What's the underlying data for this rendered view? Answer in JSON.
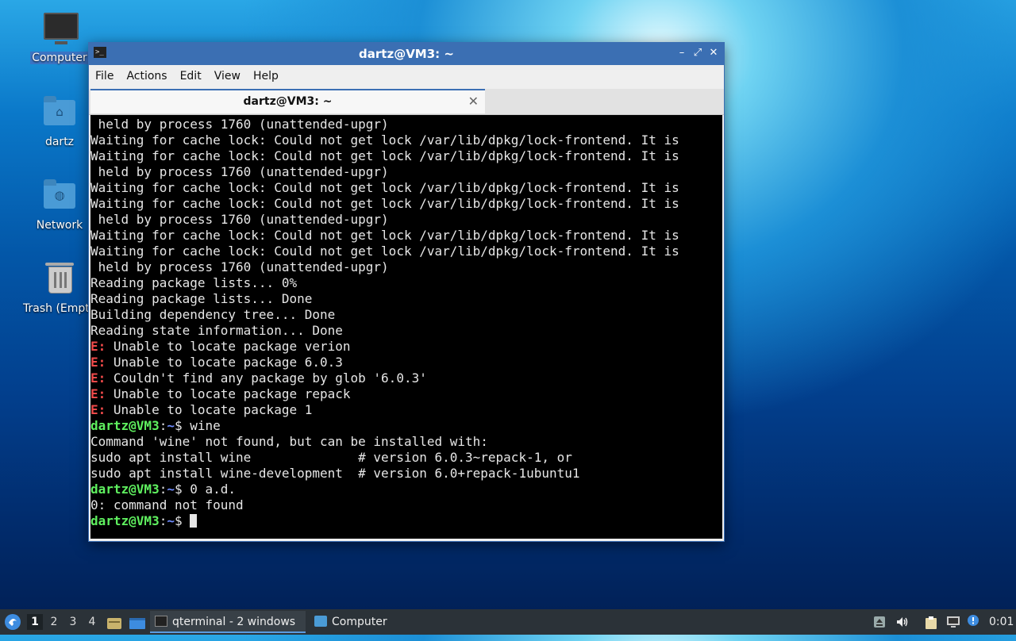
{
  "desktop": {
    "icons": [
      {
        "label": "Computer"
      },
      {
        "label": "dartz"
      },
      {
        "label": "Network"
      },
      {
        "label": "Trash (Empty)"
      }
    ]
  },
  "window": {
    "title": "dartz@VM3: ~",
    "controls": {
      "minimize": "–",
      "maximize": "⤢",
      "close": "✕"
    },
    "menu": [
      "File",
      "Actions",
      "Edit",
      "View",
      "Help"
    ],
    "tab": {
      "label": "dartz@VM3: ~",
      "close": "✕"
    }
  },
  "terminal": {
    "lines": [
      {
        "kind": "text",
        "text": " held by process 1760 (unattended-upgr)"
      },
      {
        "kind": "text",
        "text": "Waiting for cache lock: Could not get lock /var/lib/dpkg/lock-frontend. It is"
      },
      {
        "kind": "text",
        "text": "Waiting for cache lock: Could not get lock /var/lib/dpkg/lock-frontend. It is"
      },
      {
        "kind": "text",
        "text": " held by process 1760 (unattended-upgr)"
      },
      {
        "kind": "text",
        "text": "Waiting for cache lock: Could not get lock /var/lib/dpkg/lock-frontend. It is"
      },
      {
        "kind": "text",
        "text": "Waiting for cache lock: Could not get lock /var/lib/dpkg/lock-frontend. It is"
      },
      {
        "kind": "text",
        "text": " held by process 1760 (unattended-upgr)"
      },
      {
        "kind": "text",
        "text": "Waiting for cache lock: Could not get lock /var/lib/dpkg/lock-frontend. It is"
      },
      {
        "kind": "text",
        "text": "Waiting for cache lock: Could not get lock /var/lib/dpkg/lock-frontend. It is"
      },
      {
        "kind": "text",
        "text": " held by process 1760 (unattended-upgr)"
      },
      {
        "kind": "text",
        "text": "Reading package lists... 0%"
      },
      {
        "kind": "text",
        "text": "Reading package lists... Done"
      },
      {
        "kind": "text",
        "text": "Building dependency tree... Done"
      },
      {
        "kind": "text",
        "text": "Reading state information... Done"
      },
      {
        "kind": "error",
        "prefix": "E:",
        "text": " Unable to locate package verion"
      },
      {
        "kind": "error",
        "prefix": "E:",
        "text": " Unable to locate package 6.0.3"
      },
      {
        "kind": "error",
        "prefix": "E:",
        "text": " Couldn't find any package by glob '6.0.3'"
      },
      {
        "kind": "error",
        "prefix": "E:",
        "text": " Unable to locate package repack"
      },
      {
        "kind": "error",
        "prefix": "E:",
        "text": " Unable to locate package 1"
      },
      {
        "kind": "prompt",
        "user": "dartz@VM3",
        "path": "~",
        "sym": "$",
        "cmd": " wine"
      },
      {
        "kind": "text",
        "text": "Command 'wine' not found, but can be installed with:"
      },
      {
        "kind": "text",
        "text": "sudo apt install wine              # version 6.0.3~repack-1, or"
      },
      {
        "kind": "text",
        "text": "sudo apt install wine-development  # version 6.0+repack-1ubuntu1"
      },
      {
        "kind": "prompt",
        "user": "dartz@VM3",
        "path": "~",
        "sym": "$",
        "cmd": " 0 a.d."
      },
      {
        "kind": "text",
        "text": "0: command not found"
      },
      {
        "kind": "prompt",
        "user": "dartz@VM3",
        "path": "~",
        "sym": "$",
        "cmd": " ",
        "cursor": true
      }
    ]
  },
  "taskbar": {
    "menu_icon": "start-menu-icon",
    "workspaces": [
      "1",
      "2",
      "3",
      "4"
    ],
    "active_workspace": "1",
    "quick_launch": [
      "file-manager-icon",
      "show-desktop-icon"
    ],
    "tasks": [
      {
        "label": "qterminal - 2 windows",
        "icon": "terminal-icon",
        "active": true
      },
      {
        "label": "Computer",
        "icon": "folder-icon",
        "active": false
      }
    ],
    "tray": [
      "removable-media-icon",
      "volume-icon",
      "clipboard-icon",
      "network-icon",
      "notification-icon"
    ],
    "clock": "0:01"
  },
  "colors": {
    "titlebar": "#3b6fb3",
    "terminal_bg": "#000000",
    "prompt_user": "#5ff05f",
    "prompt_path": "#6f8cff",
    "error": "#ef4a4a",
    "taskbar": "#2b3238"
  }
}
